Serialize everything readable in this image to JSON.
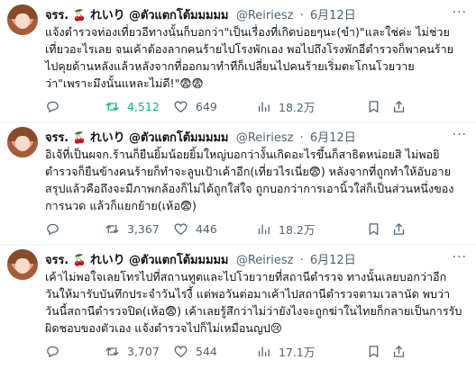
{
  "tweets": [
    {
      "author": {
        "name_prefix": "จรร.",
        "name_mid": "れいり",
        "name_suffix": "@ตัวแตกโต้มมมมม",
        "handle": "@Reiriesz"
      },
      "date": "6月12日",
      "lines": [
        "แจ้งตำรวจท่องเที่ยวอีทางนั้นก็บอกว่า\"เป็นเรื่องที่เกิดบ่อยๆนะ(ขำ)\"และใช่ค่ะ ไม่ช่วย",
        "เที่ยวอะไรเลย จนเค้าต้องลากคนร้ายไปโรงพักเอง พอไปถึงโรงพักอีตำรวจก็พาคนร้าย",
        "ไปคุยด้านหลังแล้วหลังจากที่ออกมาทำทีก็เปลี่ยนไปคนร้ายเริ่มตะโกนโวยวาย",
        "ว่า\"เพราะมึงนั้นแหละไม่ดี!\"😨😨"
      ],
      "stats": {
        "replies": "",
        "retweets": "4,512",
        "likes": "649",
        "views": "18.2万"
      },
      "retweeted": true
    },
    {
      "author": {
        "name_prefix": "จรร.",
        "name_mid": "れいり",
        "name_suffix": "@ตัวแตกโต้มมมมม",
        "handle": "@Reiriesz"
      },
      "date": "6月12日",
      "lines": [
        "อิเจ้ที่เป็นผจก.ร้านก็ยืนยิ้มน้อยยิ้มใหญ่บอกว่างั้นเกิดอะไรขึ้นก็สาธิตหน่อยสิ ไม่พอยิ",
        "ตำรวจก็ยืนข้างคนร้ายก็ทำจะลูบเป้าเค้าอีก(เที่ยวไรเนี่ย😨) หลังจากที่ถูกทำให้อับอาย",
        "สรุปแล้วคือถึงจะมีภาพกล้องก็ไม่ได้ถูกใส่ใจ ถูกบอกว่าการเอานิ้วใส่ก็เป็นส่วนหนึ่งของ",
        "การนวด แล้วก็แยกย้าย(เห้อ😨)"
      ],
      "stats": {
        "replies": "",
        "retweets": "3,367",
        "likes": "446",
        "views": "18.2万"
      },
      "retweeted": false
    },
    {
      "author": {
        "name_prefix": "จรร.",
        "name_mid": "れいり",
        "name_suffix": "@ตัวแตกโต้มมมมม",
        "handle": "@Reiriesz"
      },
      "date": "6月12日",
      "lines": [
        "เค้าไม่พอใจเลยโทรไปที่สถานทูตและไปโวยวายที่สถานีตำรวจ ทางนั้นเลยบอกว่าอีก",
        "วันให้มารับบันทึกประจำวันไรงี้ แต่พอวันต่อมาเค้าไปสถานีตำรวจตามเวลานัด พบว่า",
        "วันนี้สถานีตำรวจปิด(เห้อ😨) เค้าเลยรู้สึกว่าไม่ว่ายังไงจะถูกฆ่าในไทยก็กลายเป็นการรับ",
        "ผิดชอบของตัวเอง แจ้งตำรวจไปก็ไม่เหมือนญป😢"
      ],
      "stats": {
        "replies": "",
        "retweets": "3,707",
        "likes": "544",
        "views": "17.1万"
      },
      "retweeted": false
    }
  ],
  "icons": {
    "reply": "reply-icon",
    "retweet": "retweet-icon",
    "like": "heart-icon",
    "views": "views-icon",
    "bookmark": "bookmark-icon",
    "share": "share-icon",
    "more": "more-icon"
  },
  "colors": {
    "retweet_active": "#00ba7c",
    "muted": "#536471"
  }
}
